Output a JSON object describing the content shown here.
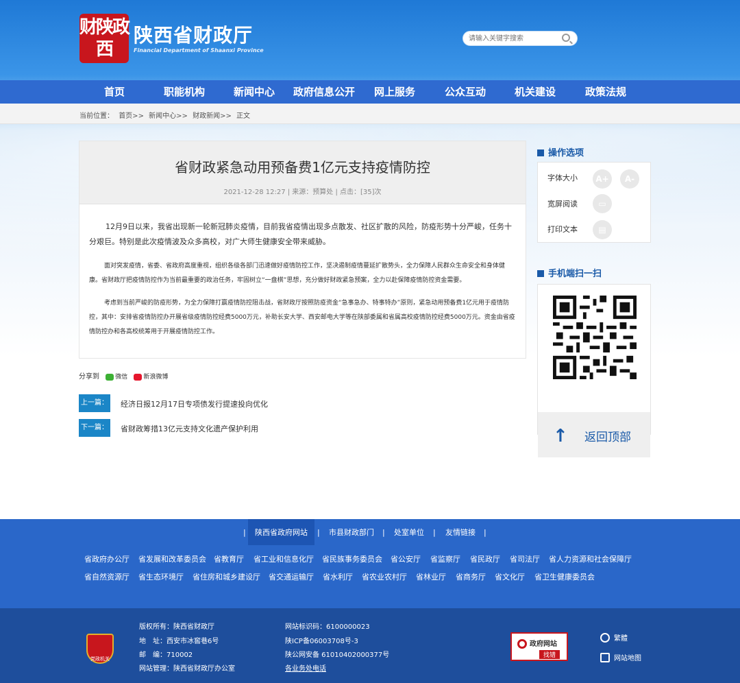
{
  "header": {
    "logo_text": "财陕政西",
    "site_title": "陕西省财政厅",
    "site_subtitle": "Financial Department of Shaanxi Province",
    "search_placeholder": "请输入关键字搜索"
  },
  "nav": {
    "items": [
      "首页",
      "职能机构",
      "新闻中心",
      "政府信息公开",
      "网上服务",
      "公众互动",
      "机关建设",
      "政策法规"
    ]
  },
  "breadcrumb": {
    "prefix": "当前位置：",
    "items": [
      "首页>>",
      "新闻中心>>",
      "财政新闻>>",
      "正文"
    ]
  },
  "article": {
    "title": "省财政紧急动用预备费1亿元支持疫情防控",
    "meta": "2021-12-28 12:27 | 来源：预算处 | 点击：[35]次",
    "paragraphs": [
      "12月9日以来，我省出现新一轮新冠肺炎疫情，目前我省疫情出现多点散发、社区扩散的风险，防疫形势十分严峻，任务十分艰巨。特别是此次疫情波及众多高校，对广大师生健康安全带来威胁。",
      "面对突发疫情，省委、省政府高度重视，组织各级各部门迅速做好疫情防控工作，坚决遏制疫情蔓延扩散势头，全力保障人民群众生命安全和身体健康。省财政厅把疫情防控作为当前最重要的政治任务，牢固树立“一盘棋”思想，充分做好财政紧急预案，全力以赴保障疫情防控资金需要。",
      "考虑到当前严峻的防疫形势，为全力保障打赢疫情防控阻击战，省财政厅按照防疫资金“急事急办、特事特办”原则，紧急动用预备费1亿元用于疫情防控，其中：安排省疫情防控办开展省级疫情防控经费5000万元，补助长安大学、西安邮电大学等在陕部委属和省属高校疫情防控经费5000万元。资金由省疫情防控办和各高校统筹用于开展疫情防控工作。"
    ]
  },
  "share": {
    "label": "分享到",
    "wechat": "微信",
    "weibo": "新浪微博"
  },
  "prev_next": {
    "prev_tag": "上一篇：",
    "prev_title": "经济日报12月17日专项债发行提速投向优化",
    "next_tag": "下一篇：",
    "next_title": "省财政筹措13亿元支持文化遗产保护利用"
  },
  "sidebar": {
    "ops_title": "操作选项",
    "font_size": "字体大小",
    "font_plus": "A+",
    "font_minus": "A-",
    "wide_read": "宽屏阅读",
    "print": "打印文本",
    "mobile_title": "手机端扫一扫",
    "back_top": "返回顶部"
  },
  "footer": {
    "link_tabs": [
      "陕西省政府网站",
      "市县财政部门",
      "处室单位",
      "友情链接"
    ],
    "depts_row1": [
      "省政府办公厅",
      "省发展和改革委员会",
      "省教育厅",
      "省工业和信息化厅",
      "省民族事务委员会",
      "省公安厅",
      "省监察厅",
      "省民政厅",
      "省司法厅",
      "省人力资源和社会保障厅"
    ],
    "depts_row2": [
      "省自然资源厅",
      "省生态环境厅",
      "省住房和城乡建设厅",
      "省交通运输厅",
      "省水利厅",
      "省农业农村厅",
      "省林业厅",
      "省商务厅",
      "省文化厅",
      "省卫生健康委员会"
    ],
    "badge_text": "党政机关",
    "info_left": [
      "版权所有：陕西省财政厅",
      "地　址：西安市冰窖巷6号",
      "邮　编：710002",
      "网站管理：陕西省财政厅办公室"
    ],
    "info_right": [
      "网站标识码：6100000023",
      "陕ICP备06003708号-3",
      "陕公网安备 61010402000377号",
      "各业务处电话"
    ],
    "gov_label": "政府网站",
    "gov_sub": "找错",
    "traditional": "繁體",
    "sitemap": "网站地图"
  }
}
